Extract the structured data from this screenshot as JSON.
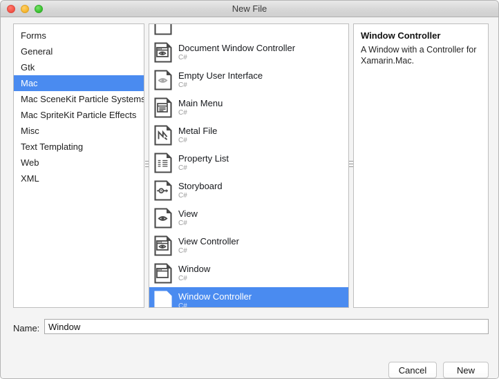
{
  "window": {
    "title": "New File",
    "traffic_lights": [
      {
        "name": "close",
        "color": "#f4564a"
      },
      {
        "name": "minimize",
        "color": "#f7b933"
      },
      {
        "name": "maximize",
        "color": "#3fc434"
      }
    ]
  },
  "accent_color": "#4a8bf0",
  "categories": {
    "items": [
      {
        "label": "Forms",
        "selected": false
      },
      {
        "label": "General",
        "selected": false
      },
      {
        "label": "Gtk",
        "selected": false
      },
      {
        "label": "Mac",
        "selected": true
      },
      {
        "label": "Mac SceneKit Particle Systems",
        "selected": false
      },
      {
        "label": "Mac SpriteKit Particle Effects",
        "selected": false
      },
      {
        "label": "Misc",
        "selected": false
      },
      {
        "label": "Text Templating",
        "selected": false
      },
      {
        "label": "Web",
        "selected": false
      },
      {
        "label": "XML",
        "selected": false
      }
    ]
  },
  "templates": {
    "items": [
      {
        "name": "",
        "language": "",
        "icon": "document-partial-icon",
        "selected": false,
        "partial": true
      },
      {
        "name": "Document Window Controller",
        "language": "C#",
        "icon": "document-window-controller-icon",
        "selected": false
      },
      {
        "name": "Empty User Interface",
        "language": "C#",
        "icon": "empty-user-interface-icon",
        "selected": false
      },
      {
        "name": "Main Menu",
        "language": "C#",
        "icon": "main-menu-icon",
        "selected": false
      },
      {
        "name": "Metal File",
        "language": "C#",
        "icon": "metal-file-icon",
        "selected": false
      },
      {
        "name": "Property List",
        "language": "C#",
        "icon": "property-list-icon",
        "selected": false
      },
      {
        "name": "Storyboard",
        "language": "C#",
        "icon": "storyboard-icon",
        "selected": false
      },
      {
        "name": "View",
        "language": "C#",
        "icon": "view-icon",
        "selected": false
      },
      {
        "name": "View Controller",
        "language": "C#",
        "icon": "view-controller-icon",
        "selected": false
      },
      {
        "name": "Window",
        "language": "C#",
        "icon": "window-icon",
        "selected": false
      },
      {
        "name": "Window Controller",
        "language": "C#",
        "icon": "window-controller-icon",
        "selected": true
      }
    ]
  },
  "details": {
    "title": "Window Controller",
    "description": "A Window with a Controller for Xamarin.Mac."
  },
  "name_field": {
    "label": "Name:",
    "value": "Window",
    "placeholder": ""
  },
  "buttons": {
    "cancel": "Cancel",
    "new": "New"
  }
}
